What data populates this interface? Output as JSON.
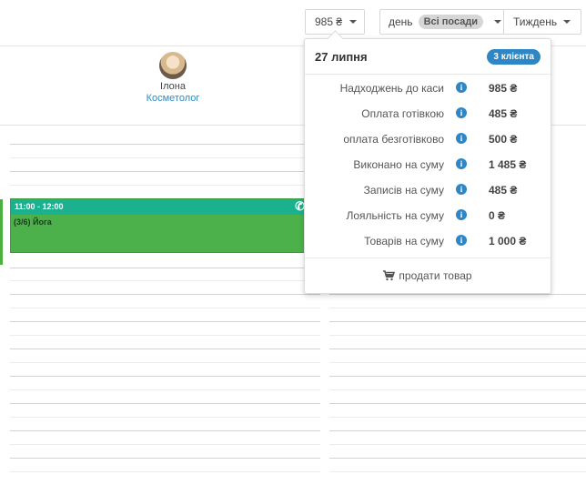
{
  "toolbar": {
    "amount_label": "985 ₴",
    "view_label": "день",
    "positions_label": "Всі посади",
    "period_label": "Тиждень"
  },
  "staff": {
    "name": "Ілона",
    "role": "Косметолог"
  },
  "event": {
    "time": "11:00 - 12:00",
    "title": "(3/6) Йога",
    "icon": "phone-icon"
  },
  "popover": {
    "date": "27 липня",
    "badge": "3 клієнта",
    "rows": [
      {
        "label": "Надходжень до каси",
        "value": "985 ₴"
      },
      {
        "label": "Оплата готівкою",
        "value": "485 ₴"
      },
      {
        "label": "оплата безготівково",
        "value": "500 ₴"
      },
      {
        "label": "Виконано на суму",
        "value": "1 485 ₴"
      },
      {
        "label": "Записів на суму",
        "value": "485 ₴"
      },
      {
        "label": "Лояльність на суму",
        "value": "0 ₴"
      },
      {
        "label": "Товарів на суму",
        "value": "1 000 ₴"
      }
    ],
    "sell_label": "продати товар"
  },
  "colors": {
    "accent_blue": "#2f86c4",
    "event_green": "#4cb14a",
    "event_header_teal": "#1bb08e"
  }
}
